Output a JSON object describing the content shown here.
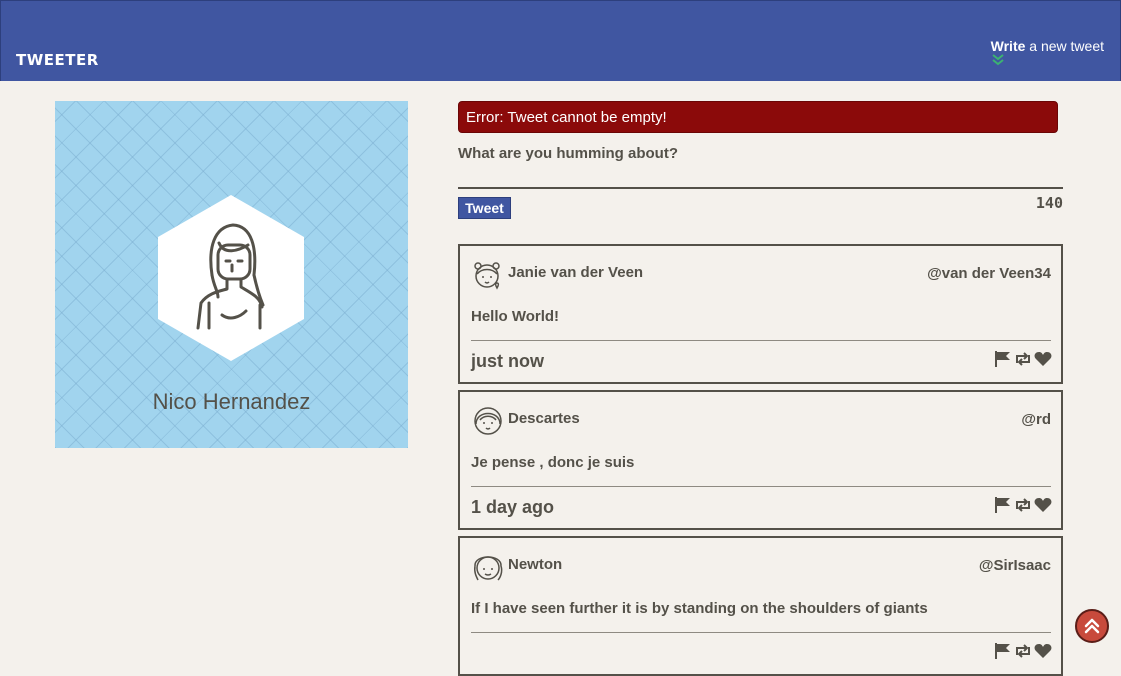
{
  "header": {
    "logo": "TWEETER",
    "compose_bold": "Write",
    "compose_rest": " a new tweet"
  },
  "profile": {
    "name": "Nico Hernandez"
  },
  "composer": {
    "error": "Error: Tweet cannot be empty!",
    "prompt": "What are you humming about?",
    "button_label": "Tweet",
    "counter": "140"
  },
  "tweets": [
    {
      "name": "Janie van der Veen",
      "handle": "@van der Veen34",
      "text": "Hello World!",
      "time": "just now"
    },
    {
      "name": "Descartes",
      "handle": "@rd",
      "text": "Je pense , donc je suis",
      "time": "1 day ago"
    },
    {
      "name": "Newton",
      "handle": "@SirIsaac",
      "text": "If I have seen further it is by standing on the shoulders of giants",
      "time": ""
    }
  ],
  "colors": {
    "nav": "#4056a1",
    "background": "#f4f1ec",
    "error": "#8b0a0a",
    "text": "#545149",
    "profile_bg": "#a1d4ee",
    "scroll_button": "#c84a3c",
    "chevron": "#3cb371"
  },
  "icons": {
    "flag": "flag-icon",
    "retweet": "retweet-icon",
    "like": "heart-icon",
    "scroll_top": "double-chevron-up-icon"
  }
}
